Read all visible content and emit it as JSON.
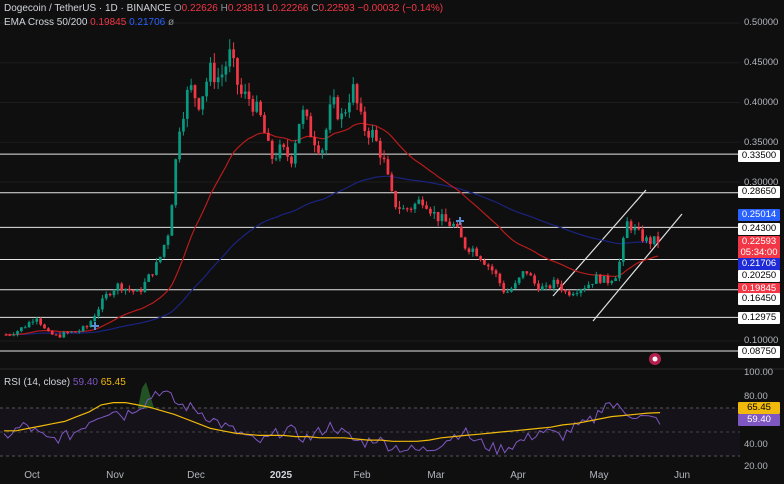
{
  "header": {
    "symbol": "Dogecoin / TetherUS · 1D · BINANCE",
    "ohlc": {
      "o_label": "O",
      "o": "0.22626",
      "h_label": "H",
      "h": "0.23813",
      "l_label": "L",
      "l": "0.22266",
      "c_label": "C",
      "c": "0.22593",
      "change": "−0.00032 (−0.14%)"
    }
  },
  "ema_legend": {
    "label": "EMA Cross 50/200",
    "ema50": "0.19845",
    "ema200": "0.21706",
    "extra": "ø"
  },
  "rsi_legend": {
    "label": "RSI (14, close)",
    "rsi": "59.40",
    "ma": "65.45"
  },
  "price_axis": [
    "0.50000",
    "0.45000",
    "0.40000",
    "0.35000",
    "0.30000",
    "0.10000"
  ],
  "rsi_axis": [
    "100.00",
    "80.00",
    "40.00",
    "20.00"
  ],
  "price_badges": [
    {
      "text": "0.33500",
      "bg": "#ffffff",
      "fg": "#000000"
    },
    {
      "text": "0.28650",
      "bg": "#ffffff",
      "fg": "#000000"
    },
    {
      "text": "0.25014",
      "bg": "#2962ff",
      "fg": "#ffffff"
    },
    {
      "text": "0.24300",
      "bg": "#ffffff",
      "fg": "#000000"
    },
    {
      "text": "0.22593",
      "bg": "#f23645",
      "fg": "#ffffff"
    },
    {
      "text": "05:34:00",
      "bg": "#f23645",
      "fg": "#ffffff"
    },
    {
      "text": "0.21706",
      "bg": "#1e2bd6",
      "fg": "#ffffff"
    },
    {
      "text": "0.20250",
      "bg": "#ffffff",
      "fg": "#000000"
    },
    {
      "text": "0.19845",
      "bg": "#f23645",
      "fg": "#ffffff"
    },
    {
      "text": "0.16450",
      "bg": "#ffffff",
      "fg": "#000000"
    },
    {
      "text": "0.12975",
      "bg": "#ffffff",
      "fg": "#000000"
    },
    {
      "text": "0.08750",
      "bg": "#ffffff",
      "fg": "#000000"
    }
  ],
  "rsi_badges": [
    {
      "text": "65.45",
      "bg": "#f0b90b",
      "fg": "#000000"
    },
    {
      "text": "59.40",
      "bg": "#7e57c2",
      "fg": "#ffffff"
    }
  ],
  "time_axis": [
    {
      "label": "Oct",
      "bold": false
    },
    {
      "label": "Nov",
      "bold": false
    },
    {
      "label": "Dec",
      "bold": false
    },
    {
      "label": "2025",
      "bold": true
    },
    {
      "label": "Feb",
      "bold": false
    },
    {
      "label": "Mar",
      "bold": false
    },
    {
      "label": "Apr",
      "bold": false
    },
    {
      "label": "May",
      "bold": false
    },
    {
      "label": "Jun",
      "bold": false
    }
  ],
  "colors": {
    "up": "#089981",
    "down": "#f23645",
    "ema50": "#b71c1c",
    "ema200": "#1a237e",
    "rsi": "#7e57c2",
    "rsi_ma": "#f0b90b",
    "bg": "#0f0f0f"
  },
  "chart_data": {
    "type": "candlestick",
    "price_levels": [
      0.335,
      0.2865,
      0.243,
      0.2025,
      0.1645,
      0.12975,
      0.0875
    ],
    "close_path": [
      0.108,
      0.112,
      0.12,
      0.132,
      0.11,
      0.106,
      0.11,
      0.112,
      0.118,
      0.14,
      0.16,
      0.17,
      0.165,
      0.16,
      0.18,
      0.2,
      0.24,
      0.37,
      0.42,
      0.4,
      0.44,
      0.43,
      0.46,
      0.41,
      0.405,
      0.38,
      0.33,
      0.34,
      0.33,
      0.39,
      0.36,
      0.34,
      0.4,
      0.38,
      0.42,
      0.37,
      0.36,
      0.33,
      0.275,
      0.265,
      0.27,
      0.28,
      0.26,
      0.25,
      0.245,
      0.22,
      0.215,
      0.2,
      0.185,
      0.16,
      0.17,
      0.19,
      0.17,
      0.165,
      0.175,
      0.16,
      0.165,
      0.17,
      0.18,
      0.175,
      0.185,
      0.25,
      0.235,
      0.225,
      0.226
    ],
    "rsi_path": [
      45,
      50,
      55,
      48,
      42,
      44,
      46,
      52,
      60,
      65,
      68,
      63,
      70,
      74,
      85,
      80,
      72,
      70,
      66,
      60,
      55,
      50,
      46,
      40,
      42,
      48,
      52,
      45,
      44,
      50,
      55,
      48,
      42,
      40,
      44,
      38,
      36,
      34,
      33,
      35,
      40,
      45,
      50,
      42,
      38,
      34,
      36,
      40,
      44,
      50,
      48,
      45,
      52,
      55,
      60,
      75,
      70,
      66,
      62,
      60,
      59
    ],
    "rsi_ma_path": [
      50,
      50,
      52,
      54,
      56,
      58,
      62,
      66,
      72,
      74,
      74,
      72,
      70,
      67,
      64,
      60,
      56,
      52,
      50,
      48,
      47,
      46,
      46,
      46,
      45,
      45,
      44,
      44,
      44,
      43,
      42,
      42,
      41,
      41,
      41,
      42,
      44,
      45,
      46,
      47,
      48,
      49,
      50,
      51,
      52,
      53,
      55,
      56,
      58,
      60,
      62,
      63,
      64,
      65,
      65.45
    ]
  }
}
